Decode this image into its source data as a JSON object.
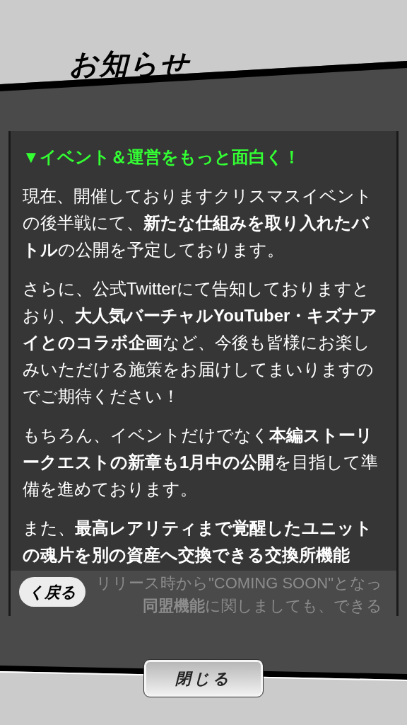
{
  "header": {
    "title": "お知らせ"
  },
  "notice": {
    "heading": "▼イベント＆運営をもっと面白く！",
    "paragraphs": [
      "現在、開催しておりますクリスマスイベントの後半戦にて、**新たな仕組みを取り入れたバトル**の公開を予定しております。",
      "さらに、公式Twitterにて告知しておりますとおり、**大人気バーチャルYouTuber・キズナアイとのコラボ企画**など、今後も皆様にお楽しみいただける施策をお届けしてまいりますのでご期待ください！",
      "もちろん、イベントだけでなく**本編ストーリークエストの新章も1月中の公開**を目指して準備を進めております。",
      "また、**最高レアリティまで覚醒したユニットの魂片を別の資産へ交換できる交換所機能**"
    ],
    "faded_lines": [
      "リリース時から\"COMING SOON\"となっ",
      "**同盟機能**に関しましても、できる"
    ]
  },
  "back_button": {
    "label": "く戻る"
  },
  "close_button": {
    "label": "閉じる"
  }
}
